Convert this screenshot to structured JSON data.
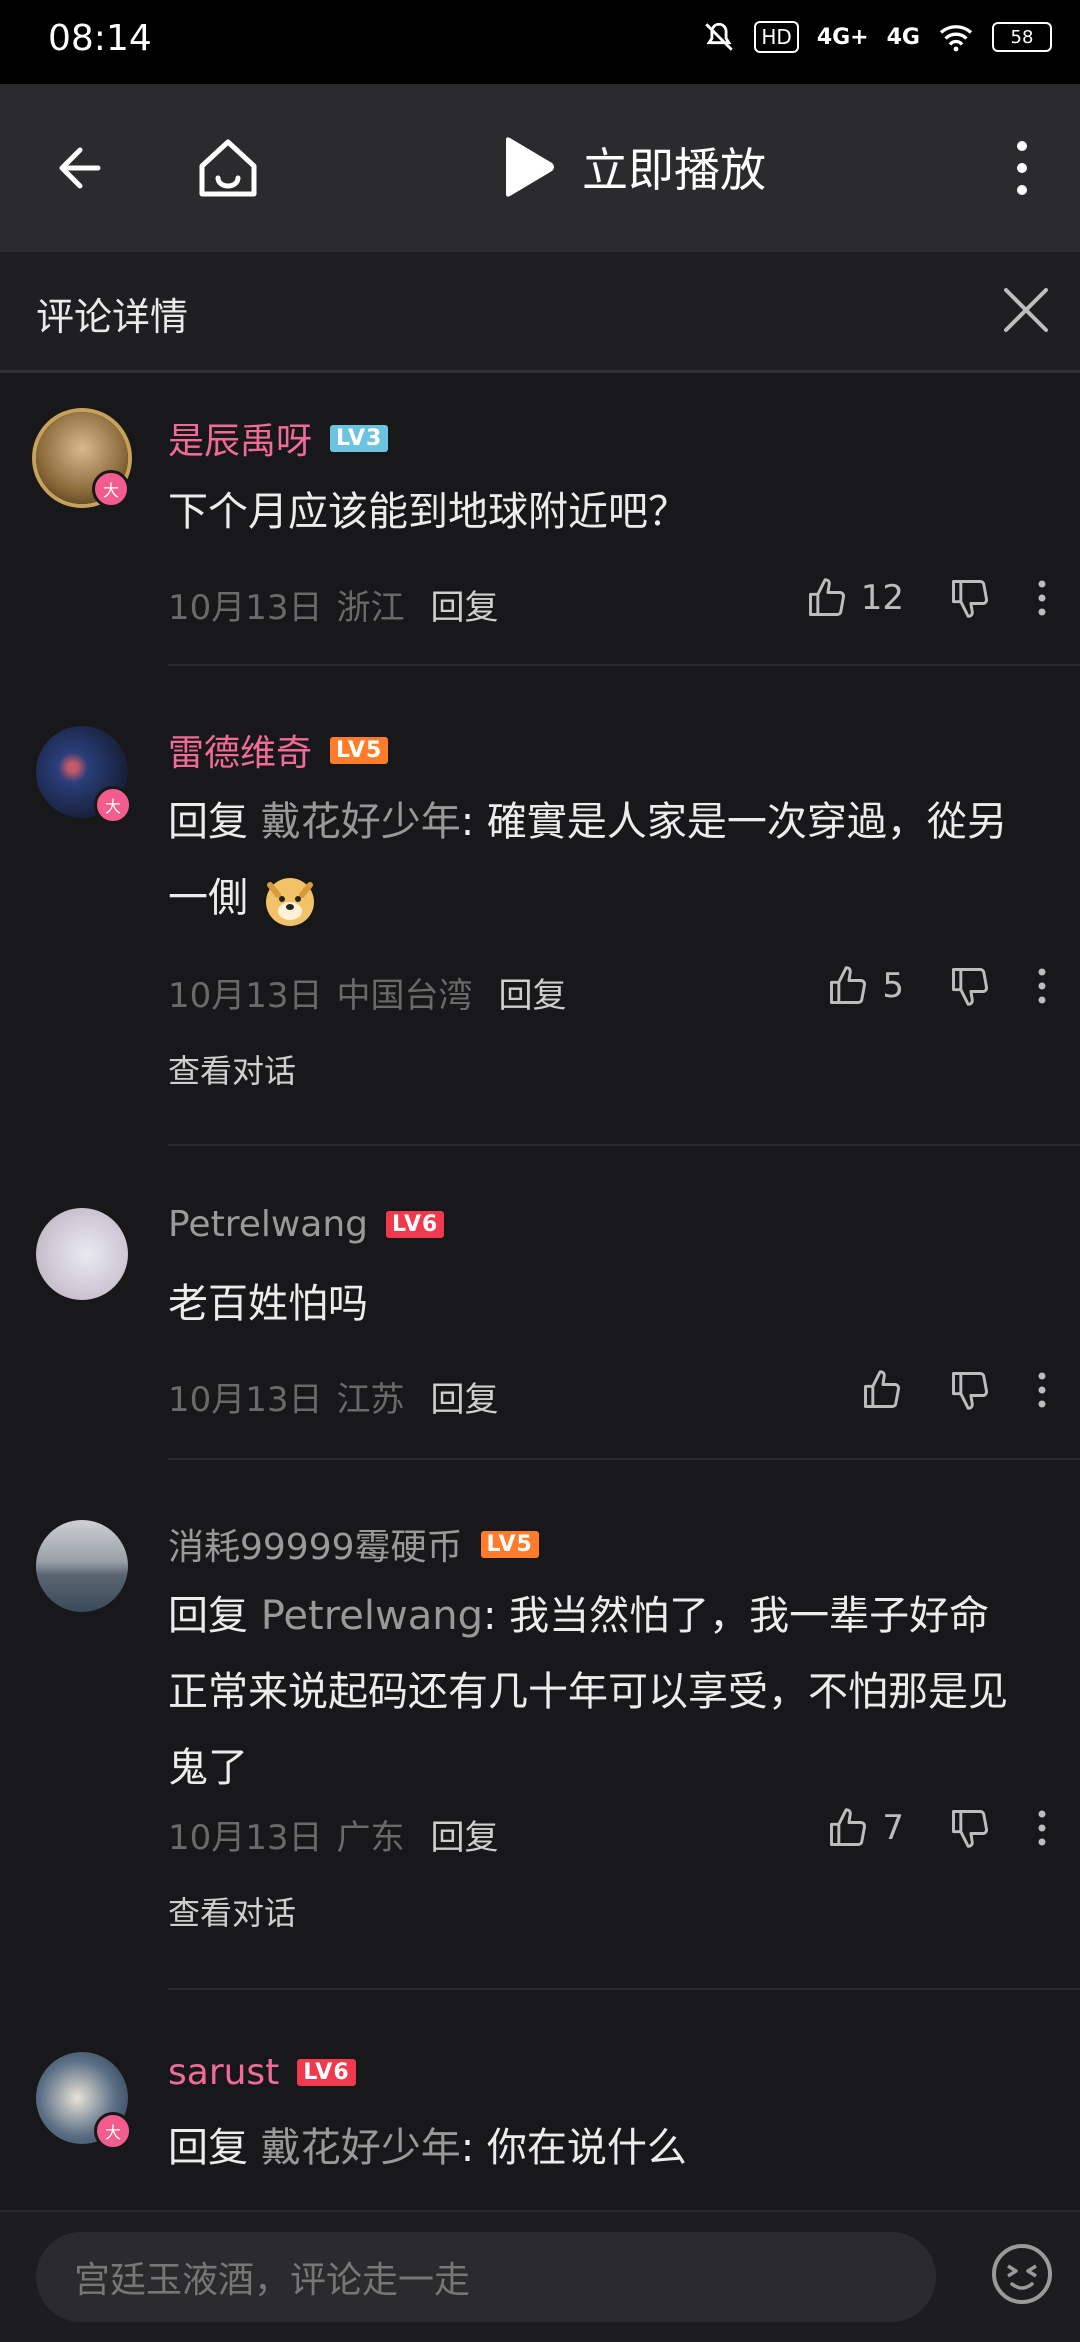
{
  "status": {
    "time": "08:14",
    "hd": "HD",
    "net1": "4G+",
    "net2": "4G",
    "battery": "58"
  },
  "topbar": {
    "play_label": "立即播放"
  },
  "subheader": {
    "title": "评论详情"
  },
  "comments": [
    {
      "name": "是辰禹呀",
      "level": "LV3",
      "text": "下个月应该能到地球附近吧？",
      "date": "10月13日",
      "location": "浙江",
      "reply": "回复",
      "likes": "12"
    },
    {
      "name": "雷德维奇",
      "level": "LV5",
      "reply_prefix": "回复 ",
      "reply_to": "戴花好少年",
      "text": ": 確實是人家是一次穿過，從另一側",
      "date": "10月13日",
      "location": "中国台湾",
      "reply": "回复",
      "likes": "5",
      "view": "查看对话"
    },
    {
      "name": "Petrelwang",
      "level": "LV6",
      "text": "老百姓怕吗",
      "date": "10月13日",
      "location": "江苏",
      "reply": "回复"
    },
    {
      "name": "消耗99999霉硬币",
      "level": "LV5",
      "reply_prefix": "回复 ",
      "reply_to": "Petrelwang",
      "text": ": 我当然怕了，我一辈子好命正常来说起码还有几十年可以享受，不怕那是见鬼了",
      "date": "10月13日",
      "location": "广东",
      "reply": "回复",
      "likes": "7",
      "view": "查看对话"
    },
    {
      "name": "sarust",
      "level": "LV6",
      "reply_prefix": "回复 ",
      "reply_to": "戴花好少年",
      "text": ": 你在说什么"
    }
  ],
  "badges": {
    "da": "大"
  },
  "input": {
    "placeholder": "宫廷玉液酒，评论走一走"
  },
  "colors": {
    "background": "#18181a",
    "accent_pink": "#f06b98",
    "lv3": "#6cc3e0",
    "lv5": "#ff7c2a",
    "lv6": "#ee3a4c"
  }
}
